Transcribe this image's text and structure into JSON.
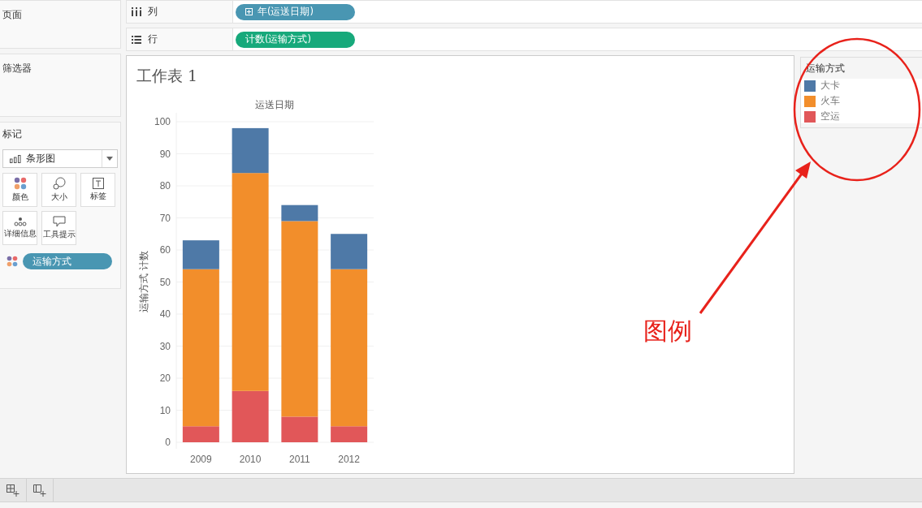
{
  "sidebar": {
    "pages_title": "页面",
    "filters_title": "筛选器",
    "marks": {
      "title": "标记",
      "mark_type": "条形图",
      "cards": [
        {
          "kind": "color",
          "label": "颜色"
        },
        {
          "kind": "size",
          "label": "大小"
        },
        {
          "kind": "label",
          "label": "标签"
        },
        {
          "kind": "detail",
          "label": "详细信息"
        },
        {
          "kind": "tooltip",
          "label": "工具提示"
        }
      ],
      "color_field": "运输方式"
    }
  },
  "shelves": [
    {
      "kind": "columns",
      "label": "列",
      "pill": "年(运送日期)",
      "expandable": true,
      "color": "#4996b2"
    },
    {
      "kind": "rows",
      "label": "行",
      "pill": "计数(运输方式)",
      "expandable": false,
      "color": "#17a97b"
    }
  ],
  "worksheet": {
    "title": "工作表 1",
    "chart_data": {
      "type": "bar",
      "stacked": true,
      "grid": true,
      "xlabel": "运送日期",
      "ylabel": "运输方式 计数",
      "categories": [
        "2009",
        "2010",
        "2011",
        "2012"
      ],
      "ylim": [
        0,
        100
      ],
      "yticks": [
        0,
        10,
        20,
        30,
        40,
        50,
        60,
        70,
        80,
        90,
        100
      ],
      "series": [
        {
          "name": "空运",
          "color": "#e15759",
          "values": [
            5,
            16,
            8,
            5
          ]
        },
        {
          "name": "火车",
          "color": "#f28e2b",
          "values": [
            49,
            68,
            61,
            49
          ]
        },
        {
          "name": "大卡",
          "color": "#4e79a7",
          "values": [
            9,
            14,
            5,
            11
          ]
        }
      ]
    }
  },
  "legend": {
    "title": "运输方式"
  },
  "annotation": {
    "text": "图例"
  }
}
